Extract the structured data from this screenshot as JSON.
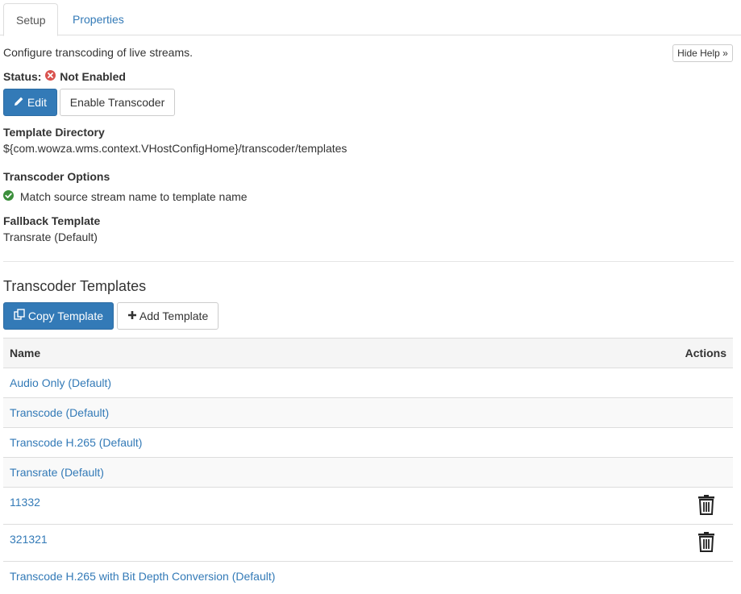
{
  "tabs": [
    {
      "label": "Setup",
      "active": true
    },
    {
      "label": "Properties",
      "active": false
    }
  ],
  "intro_text": "Configure transcoding of live streams.",
  "hide_help_label": "Hide Help",
  "hide_help_icon": "»",
  "status": {
    "label": "Status:",
    "value": "Not Enabled",
    "icon": "error-circle-icon",
    "color": "#d9534f"
  },
  "buttons": {
    "edit": "Edit",
    "enable": "Enable Transcoder"
  },
  "template_directory": {
    "label": "Template Directory",
    "value": "${com.wowza.wms.context.VHostConfigHome}/transcoder/templates"
  },
  "transcoder_options": {
    "label": "Transcoder Options",
    "items": [
      {
        "text": "Match source stream name to template name",
        "icon": "check-circle-icon",
        "color": "#3c8f3c"
      }
    ]
  },
  "fallback_template": {
    "label": "Fallback Template",
    "value": "Transrate (Default)"
  },
  "templates_section": {
    "title": "Transcoder Templates",
    "copy_label": "Copy Template",
    "add_label": "Add Template"
  },
  "table": {
    "headers": {
      "name": "Name",
      "actions": "Actions"
    },
    "rows": [
      {
        "name": "Audio Only (Default)",
        "deletable": false
      },
      {
        "name": "Transcode (Default)",
        "deletable": false
      },
      {
        "name": "Transcode H.265 (Default)",
        "deletable": false
      },
      {
        "name": "Transrate (Default)",
        "deletable": false
      },
      {
        "name": "11332",
        "deletable": true
      },
      {
        "name": "321321",
        "deletable": true
      },
      {
        "name": "Transcode H.265 with Bit Depth Conversion (Default)",
        "deletable": false
      }
    ]
  },
  "colors": {
    "link": "#337ab7",
    "primary": "#337ab7"
  }
}
